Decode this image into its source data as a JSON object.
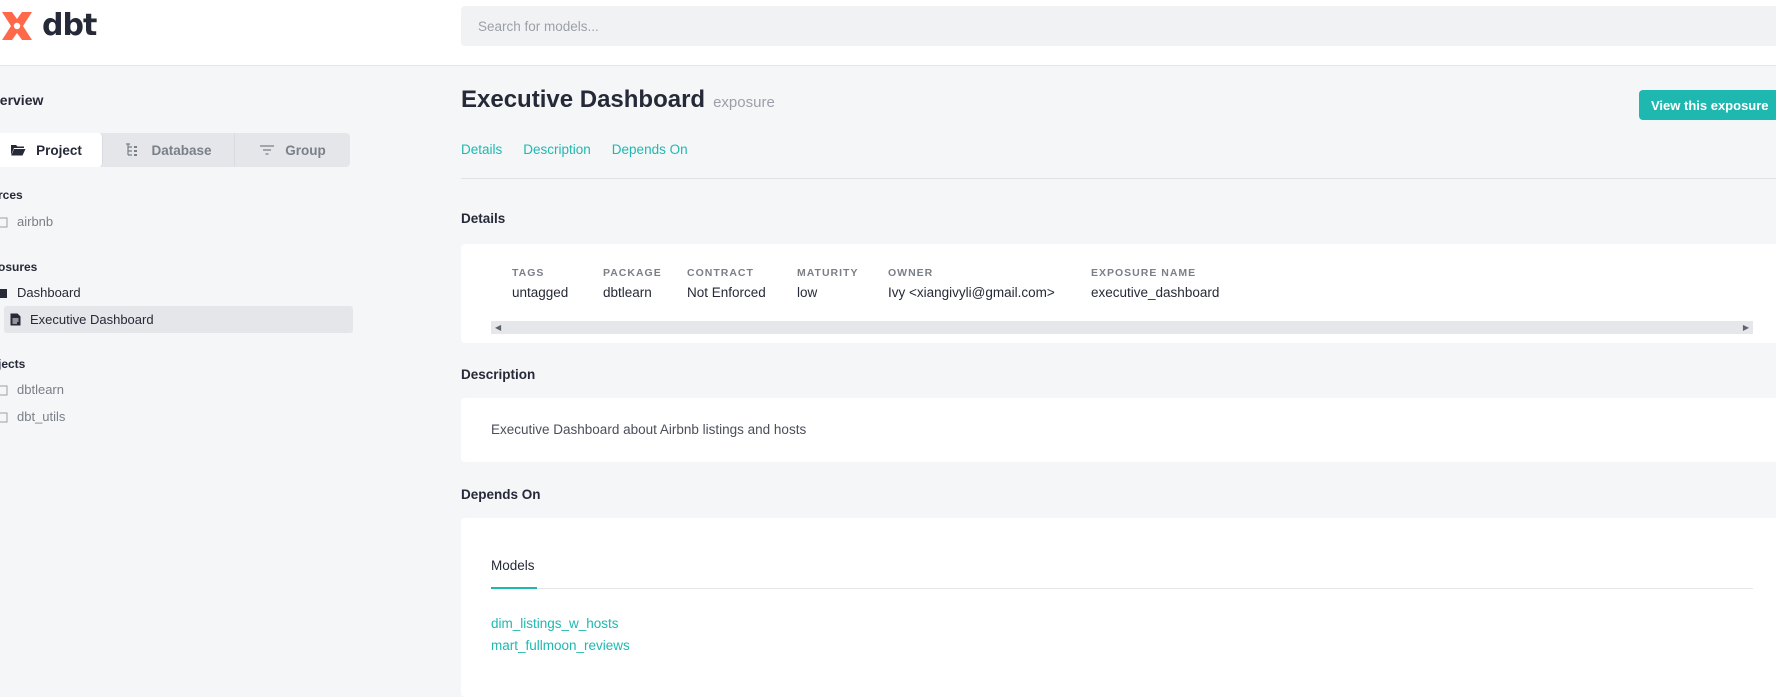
{
  "app": {
    "logo_text": "dbt",
    "brand_color": "#ff694a",
    "accent_color": "#1fb8b0"
  },
  "search": {
    "placeholder": "Search for models..."
  },
  "sidebar": {
    "title": "verview",
    "tabs": [
      {
        "label": "Project",
        "icon": "folder-open-icon",
        "active": true
      },
      {
        "label": "Database",
        "icon": "database-tree-icon",
        "active": false
      },
      {
        "label": "Group",
        "icon": "filter-lines-icon",
        "active": false
      }
    ],
    "sections": [
      {
        "heading": "rces",
        "items": [
          {
            "label": "airbnb",
            "icon": "folder-icon"
          }
        ]
      },
      {
        "heading": "osures",
        "items": [
          {
            "label": "Dashboard",
            "icon": "folder-filled-icon"
          },
          {
            "label": "Executive Dashboard",
            "icon": "document-icon",
            "selected": true
          }
        ]
      },
      {
        "heading": "jects",
        "items": [
          {
            "label": "dbtlearn",
            "icon": "folder-icon"
          },
          {
            "label": "dbt_utils",
            "icon": "folder-icon"
          }
        ]
      }
    ]
  },
  "main": {
    "title": "Executive Dashboard",
    "resource_type": "exposure",
    "view_button": "View this exposure",
    "anchors": [
      "Details",
      "Description",
      "Depends On"
    ],
    "details": {
      "heading": "Details",
      "fields": [
        {
          "label": "TAGS",
          "value": "untagged"
        },
        {
          "label": "PACKAGE",
          "value": "dbtlearn"
        },
        {
          "label": "CONTRACT",
          "value": "Not Enforced"
        },
        {
          "label": "MATURITY",
          "value": "low"
        },
        {
          "label": "OWNER",
          "value": "Ivy <xiangivyli@gmail.com>"
        },
        {
          "label": "EXPOSURE NAME",
          "value": "executive_dashboard"
        }
      ]
    },
    "description": {
      "heading": "Description",
      "text": "Executive Dashboard about Airbnb listings and hosts"
    },
    "depends_on": {
      "heading": "Depends On",
      "tab_label": "Models",
      "models": [
        "dim_listings_w_hosts",
        "mart_fullmoon_reviews"
      ]
    }
  }
}
